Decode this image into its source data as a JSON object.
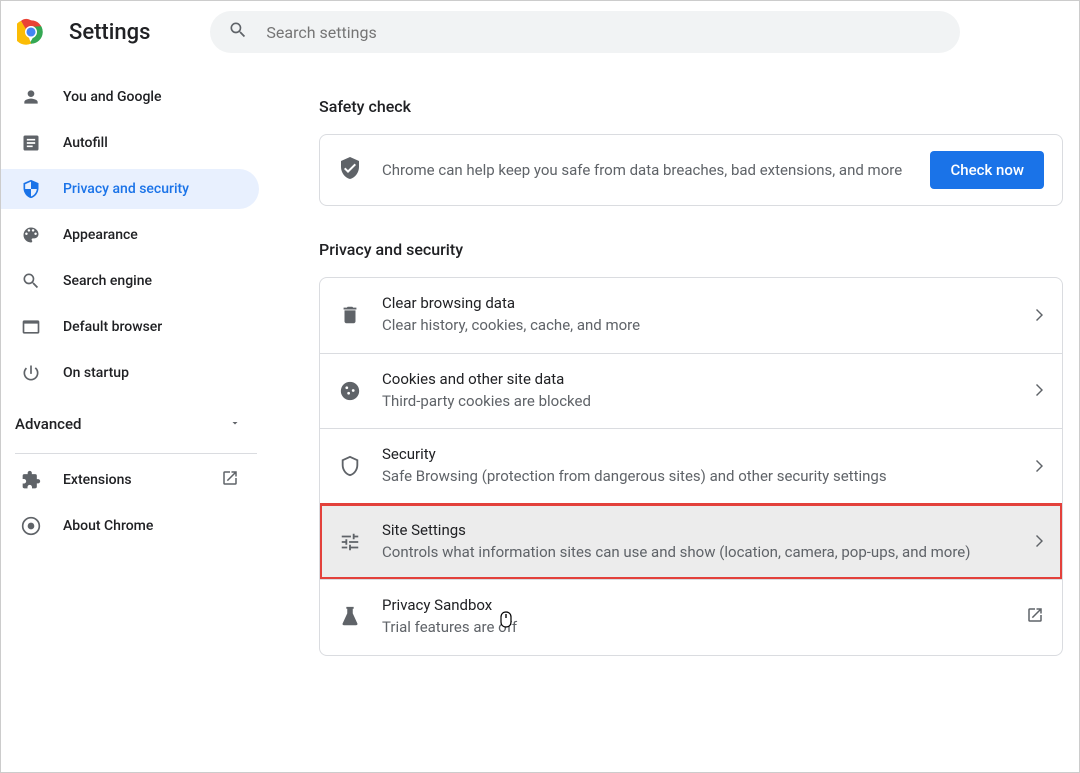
{
  "header": {
    "title": "Settings",
    "search_placeholder": "Search settings"
  },
  "sidebar": {
    "items": [
      {
        "label": "You and Google",
        "icon": "person"
      },
      {
        "label": "Autofill",
        "icon": "autofill"
      },
      {
        "label": "Privacy and security",
        "icon": "shield",
        "active": true
      },
      {
        "label": "Appearance",
        "icon": "palette"
      },
      {
        "label": "Search engine",
        "icon": "search"
      },
      {
        "label": "Default browser",
        "icon": "browser"
      },
      {
        "label": "On startup",
        "icon": "power"
      }
    ],
    "advanced_label": "Advanced",
    "footer": [
      {
        "label": "Extensions",
        "icon": "extension",
        "external": true
      },
      {
        "label": "About Chrome",
        "icon": "chrome"
      }
    ]
  },
  "content": {
    "safety_check": {
      "title": "Safety check",
      "text": "Chrome can help keep you safe from data breaches, bad extensions, and more",
      "button": "Check now"
    },
    "privacy": {
      "title": "Privacy and security",
      "items": [
        {
          "icon": "trash",
          "primary": "Clear browsing data",
          "secondary": "Clear history, cookies, cache, and more"
        },
        {
          "icon": "cookie",
          "primary": "Cookies and other site data",
          "secondary": "Third-party cookies are blocked"
        },
        {
          "icon": "security",
          "primary": "Security",
          "secondary": "Safe Browsing (protection from dangerous sites) and other security settings"
        },
        {
          "icon": "tune",
          "primary": "Site Settings",
          "secondary": "Controls what information sites can use and show (location, camera, pop-ups, and more)",
          "highlighted": true
        },
        {
          "icon": "flask",
          "primary": "Privacy Sandbox",
          "secondary": "Trial features are off",
          "external": true
        }
      ]
    }
  }
}
